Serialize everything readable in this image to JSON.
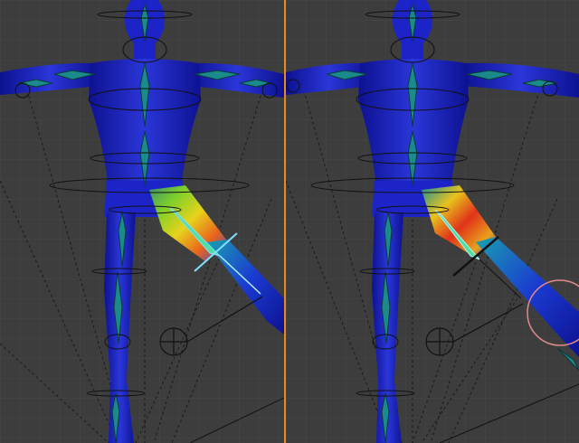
{
  "app": {
    "editor": "3d-viewport-weight-paint",
    "split": "side-by-side"
  },
  "colors": {
    "background": "#3d3d3d",
    "grid": "#474747",
    "divider": "#e8891c",
    "mesh_cold": "#1a1fb8",
    "weight_hot": "#e0321a",
    "bone": "#1b8a8a",
    "selected_bone": "#7fe0ff",
    "brush_circle": "#e08a8a"
  },
  "viewports": [
    {
      "id": "left",
      "state": "weights-before"
    },
    {
      "id": "right",
      "state": "weights-after"
    }
  ]
}
